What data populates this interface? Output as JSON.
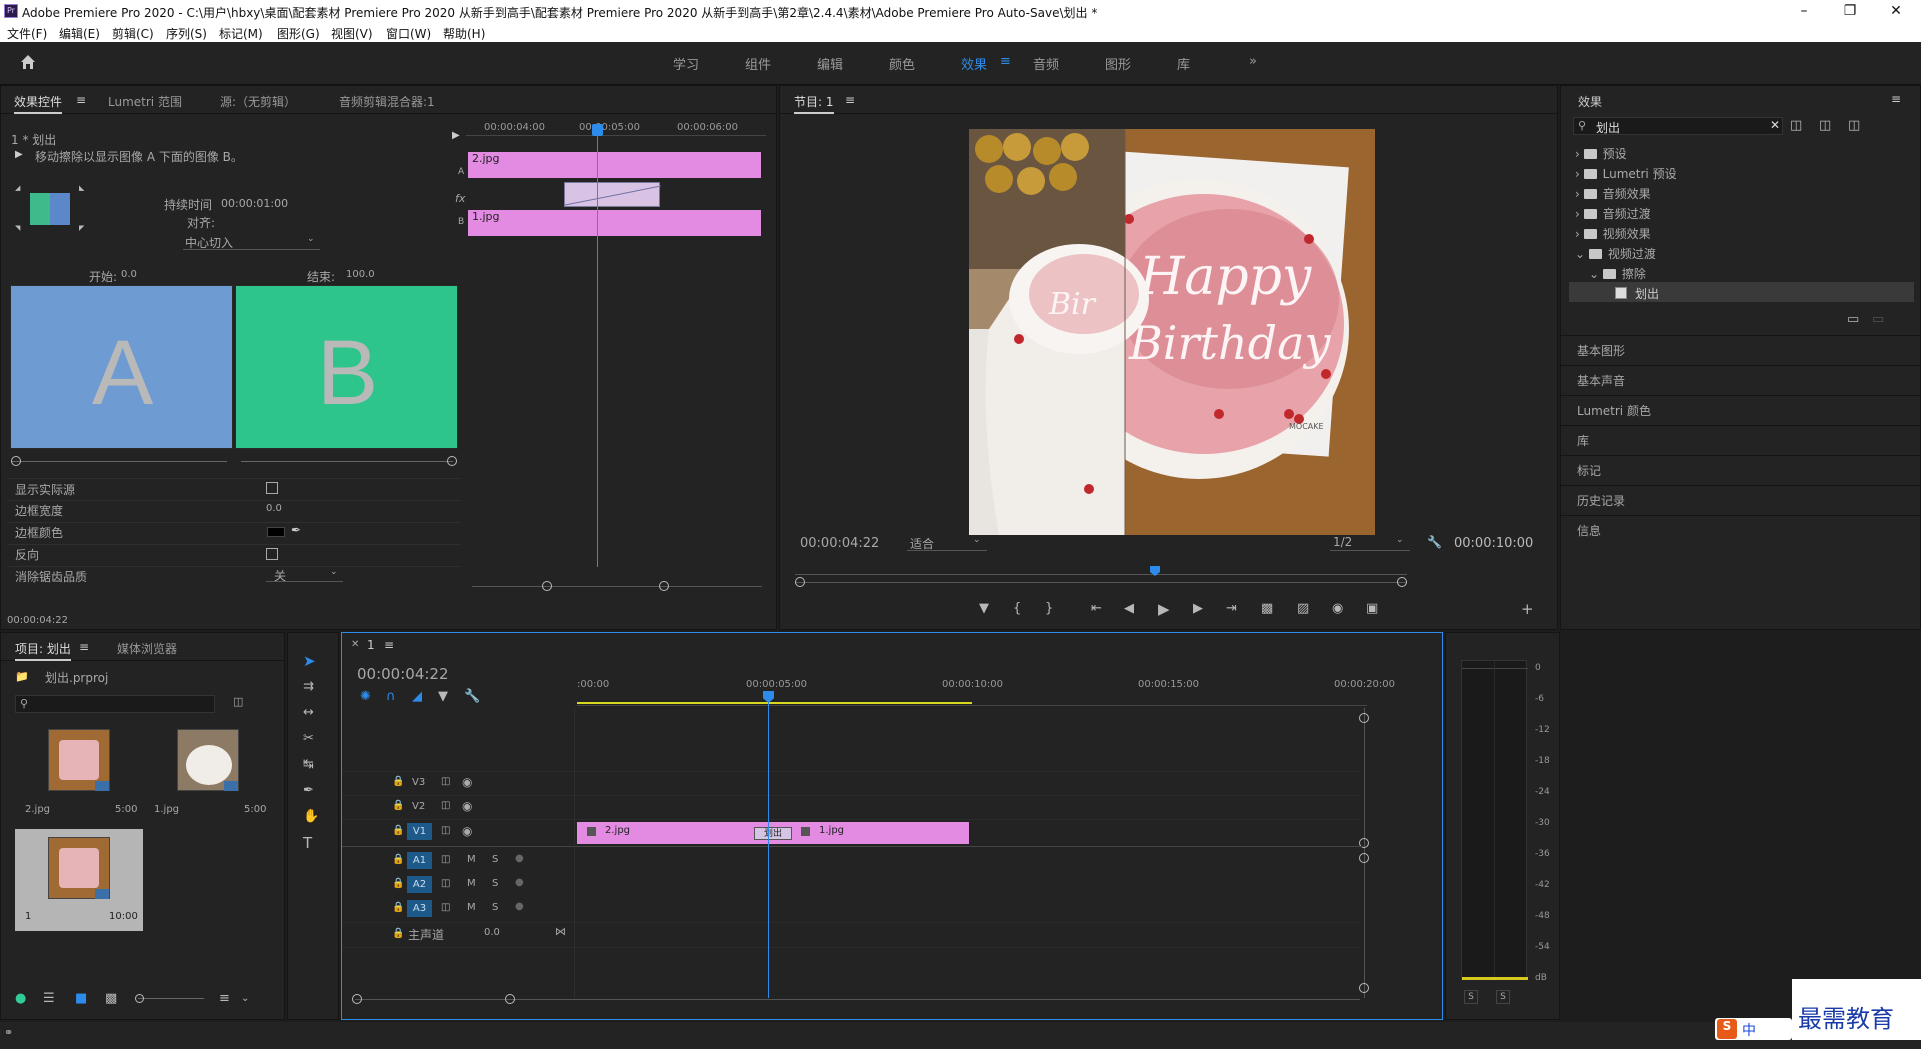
{
  "app": {
    "title": "Adobe Premiere Pro 2020 - C:\\用户\\hbxy\\桌面\\配套素材 Premiere Pro 2020 从新手到高手\\配套素材 Premiere Pro 2020 从新手到高手\\第2章\\2.4.4\\素材\\Adobe Premiere Pro Auto-Save\\划出 *",
    "logo": "Pr"
  },
  "menu": [
    "文件(F)",
    "编辑(E)",
    "剪辑(C)",
    "序列(S)",
    "标记(M)",
    "图形(G)",
    "视图(V)",
    "窗口(W)",
    "帮助(H)"
  ],
  "workspaces": [
    "学习",
    "组件",
    "编辑",
    "颜色",
    "效果",
    "音频",
    "图形",
    "库"
  ],
  "active_workspace": "效果",
  "effect_controls": {
    "tabs": [
      "效果控件",
      "Lumetri 范围",
      "源:（无剪辑）",
      "音频剪辑混合器:1"
    ],
    "clip": "1 * 划出",
    "description": "移动擦除以显示图像 A 下面的图像 B。",
    "duration_label": "持续时间",
    "duration": "00:00:01:00",
    "align_label": "对齐:",
    "align_value": "中心切入",
    "start_label": "开始:",
    "start_value": "0.0",
    "end_label": "结束:",
    "end_value": "100.0",
    "a_letter": "A",
    "b_letter": "B",
    "props": [
      {
        "label": "显示实际源",
        "value": ""
      },
      {
        "label": "边框宽度",
        "value": "0.0"
      },
      {
        "label": "边框颜色",
        "value": ""
      },
      {
        "label": "反向",
        "value": ""
      },
      {
        "label": "消除锯齿品质",
        "value": "关"
      }
    ],
    "ruler": [
      "00:00:04:00",
      "00:00:05:00",
      "00:00:06:00"
    ],
    "track_a": "A",
    "track_b": "B",
    "fx": "fx",
    "clip_a": "2.jpg",
    "clip_b": "1.jpg",
    "timecode": "00:00:04:22"
  },
  "program": {
    "title": "节目: 1",
    "timecode": "00:00:04:22",
    "fit": "适合",
    "resolution": "1/2",
    "duration": "00:00:10:00",
    "image": {
      "cake_text": "Happy Birthday",
      "left_text": "Bir",
      "brand": "MOCAKE"
    }
  },
  "effects_panel": {
    "title": "效果",
    "search": "划出",
    "tree": [
      {
        "label": "预设",
        "level": 0,
        "open": false
      },
      {
        "label": "Lumetri 预设",
        "level": 0,
        "open": false
      },
      {
        "label": "音频效果",
        "level": 0,
        "open": false
      },
      {
        "label": "音频过渡",
        "level": 0,
        "open": false
      },
      {
        "label": "视频效果",
        "level": 0,
        "open": false
      },
      {
        "label": "视频过渡",
        "level": 0,
        "open": true
      },
      {
        "label": "擦除",
        "level": 1,
        "open": true
      },
      {
        "label": "划出",
        "level": 2,
        "open": false
      }
    ],
    "sections": [
      "基本图形",
      "基本声音",
      "Lumetri 颜色",
      "库",
      "标记",
      "历史记录",
      "信息"
    ]
  },
  "project": {
    "tabs": [
      "项目: 划出",
      "媒体浏览器"
    ],
    "file": "划出.prproj",
    "items": [
      {
        "name": "2.jpg",
        "dur": "5:00"
      },
      {
        "name": "1.jpg",
        "dur": "5:00"
      },
      {
        "name": "1",
        "dur": "10:00"
      }
    ]
  },
  "timeline": {
    "tab": "1",
    "timecode": "00:00:04:22",
    "ruler": [
      ":00:00",
      "00:00:05:00",
      "00:00:10:00",
      "00:00:15:00",
      "00:00:20:00"
    ],
    "video_tracks": [
      "V3",
      "V2",
      "V1"
    ],
    "audio_tracks": [
      "A1",
      "A2",
      "A3"
    ],
    "master": "主声道",
    "master_val": "0.0",
    "clip1": "2.jpg",
    "clip2": "1.jpg",
    "transition": "划出",
    "m": "M",
    "s": "S"
  },
  "meter": {
    "labels": [
      "0",
      "-6",
      "-12",
      "-18",
      "-24",
      "-30",
      "-36",
      "-42",
      "-48",
      "-54",
      "dB"
    ],
    "s": "S"
  },
  "watermark": {
    "text": "最需教育",
    "ime": "中"
  }
}
